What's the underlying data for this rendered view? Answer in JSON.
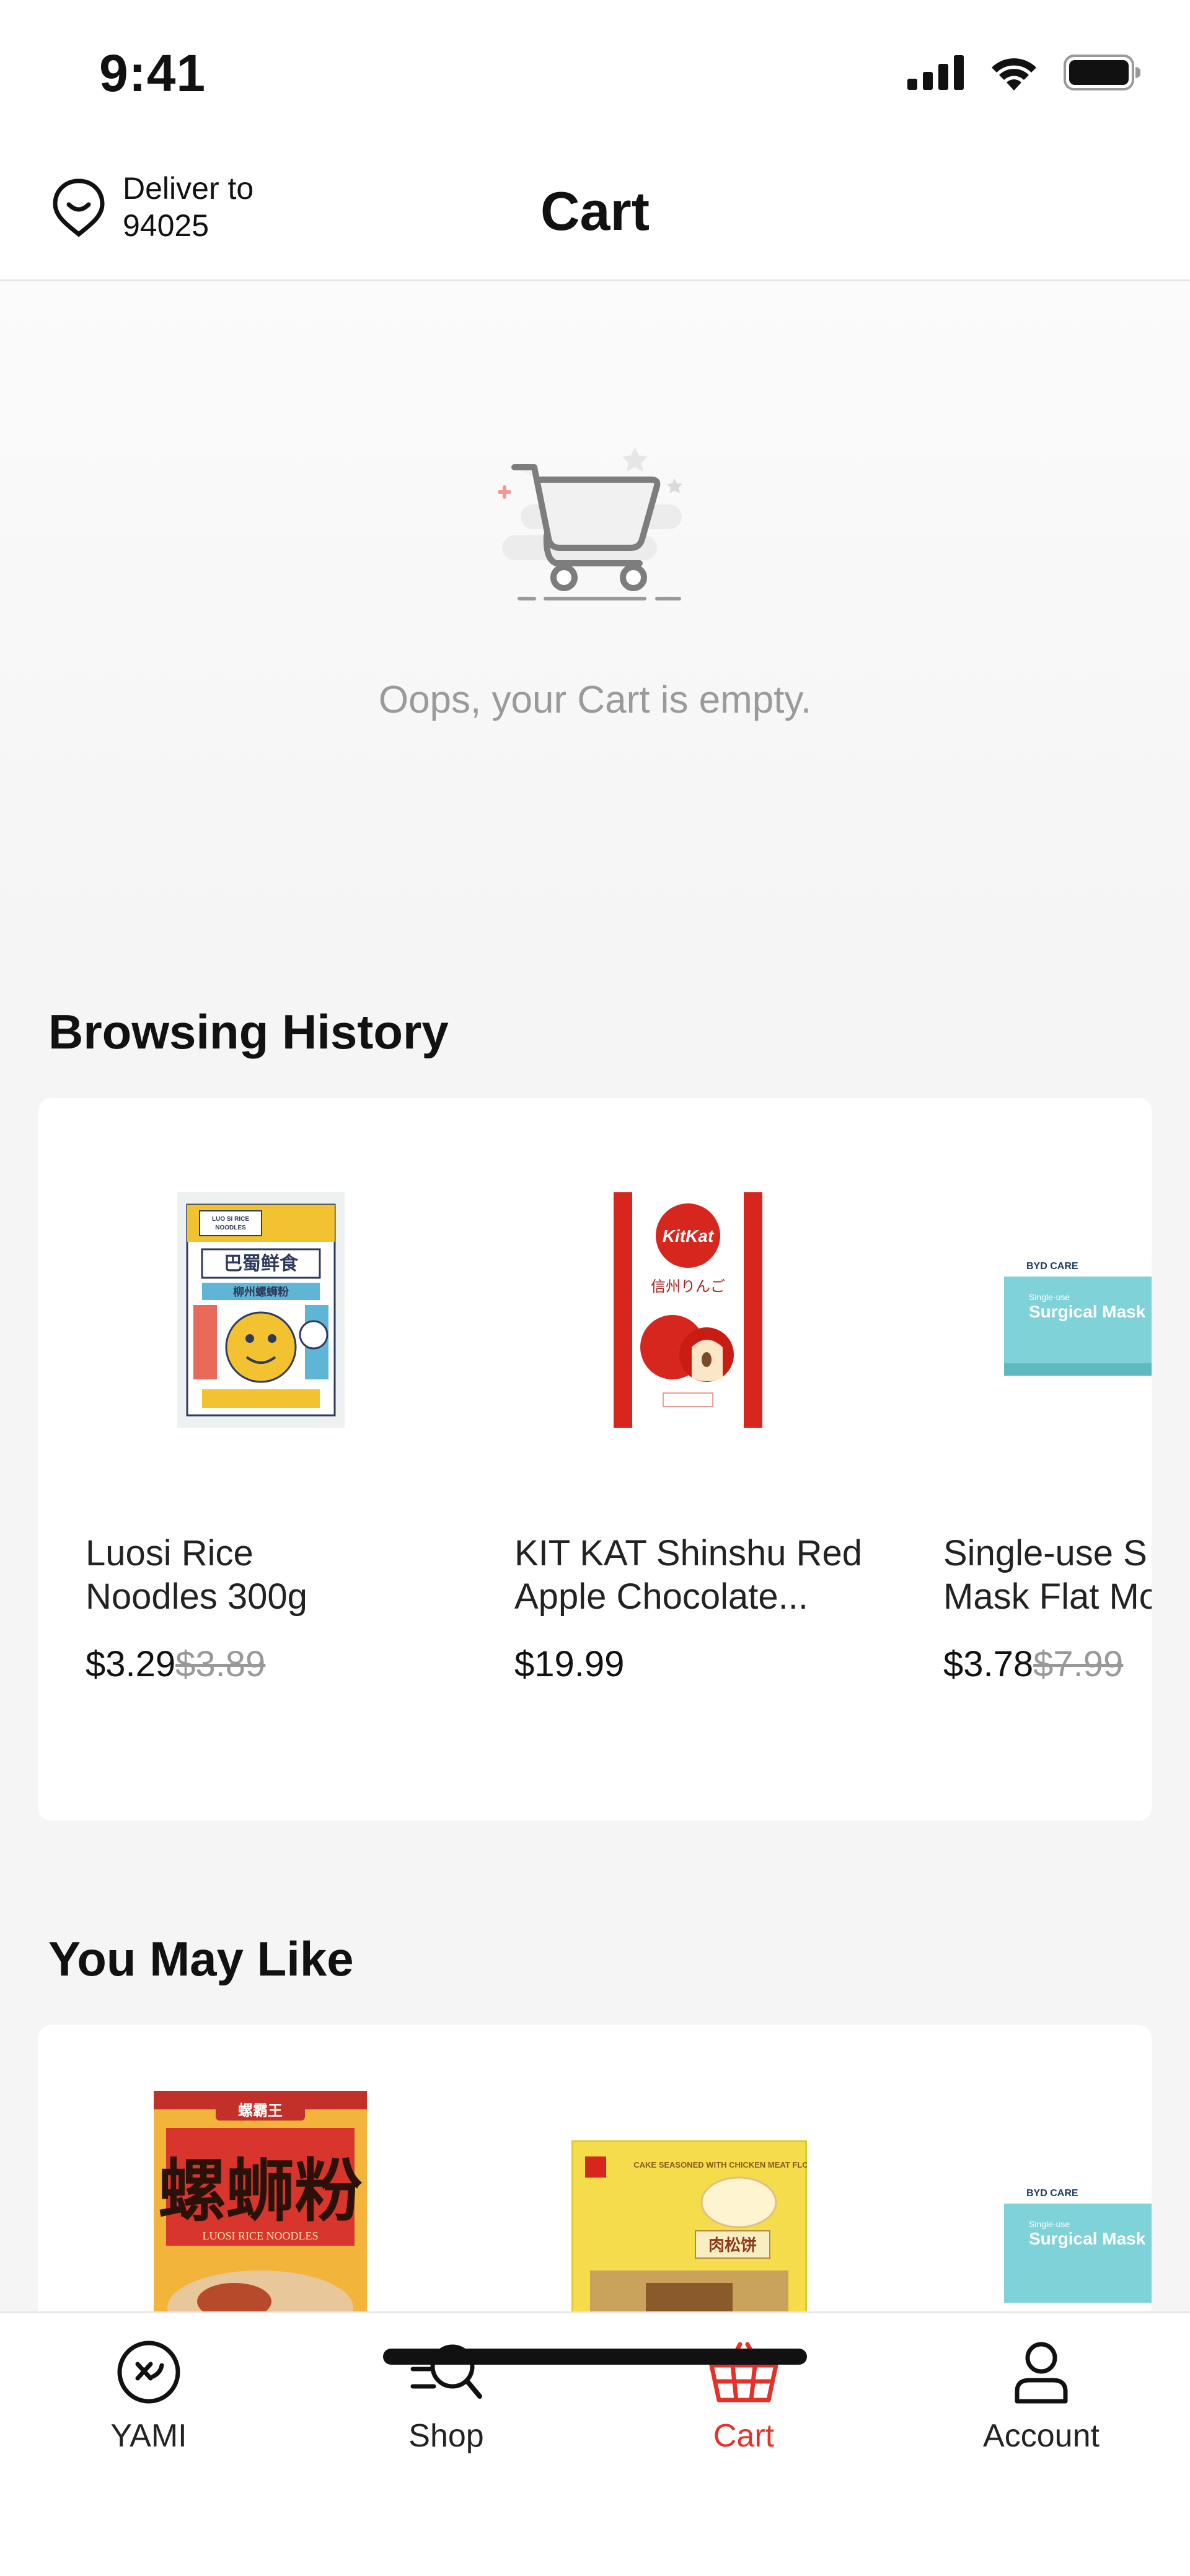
{
  "status": {
    "time": "9:41"
  },
  "header": {
    "deliver_label": "Deliver to",
    "zip": "94025",
    "title": "Cart"
  },
  "empty_state": {
    "message": "Oops, your Cart is empty."
  },
  "browsing_history": {
    "title": "Browsing History",
    "items": [
      {
        "name_line1": "Luosi Rice",
        "name_line2": "Noodles 300g",
        "price": "$3.29",
        "old_price": "$3.89"
      },
      {
        "name_line1": "KIT KAT Shinshu Red",
        "name_line2": "Apple Chocolate...",
        "price": "$19.99",
        "old_price": ""
      },
      {
        "name_line1": "Single-use S",
        "name_line2": "Mask Flat Mo",
        "price": "$3.78",
        "old_price": "$7.99"
      }
    ]
  },
  "you_may_like": {
    "title": "You May Like"
  },
  "nav": {
    "items": [
      {
        "label": "YAMI",
        "icon": "yami-logo-icon"
      },
      {
        "label": "Shop",
        "icon": "shop-search-icon"
      },
      {
        "label": "Cart",
        "icon": "basket-icon"
      },
      {
        "label": "Account",
        "icon": "user-icon"
      }
    ],
    "active": "Cart",
    "accent": "#e5312a"
  },
  "product_labels": {
    "luosi": {
      "brand": "LUO SI RICE NOODLES",
      "cn": "巴蜀鲜食",
      "sub": "柳州螺蛳粉"
    },
    "kitkat": {
      "brand": "KitKat",
      "jp": "信州りんご"
    },
    "mask": {
      "brand": "BYD CARE",
      "line1": "Single-use",
      "line2": "Surgical Mask"
    },
    "luobawang": {
      "cn": "螺蛳粉",
      "top": "螺霸王",
      "en": "LUOSI RICE NOODLES"
    },
    "pastry": {
      "en": "CAKE SEASONED WITH CHICKEN MEAT FLOSS",
      "cn": "肉松饼"
    }
  }
}
